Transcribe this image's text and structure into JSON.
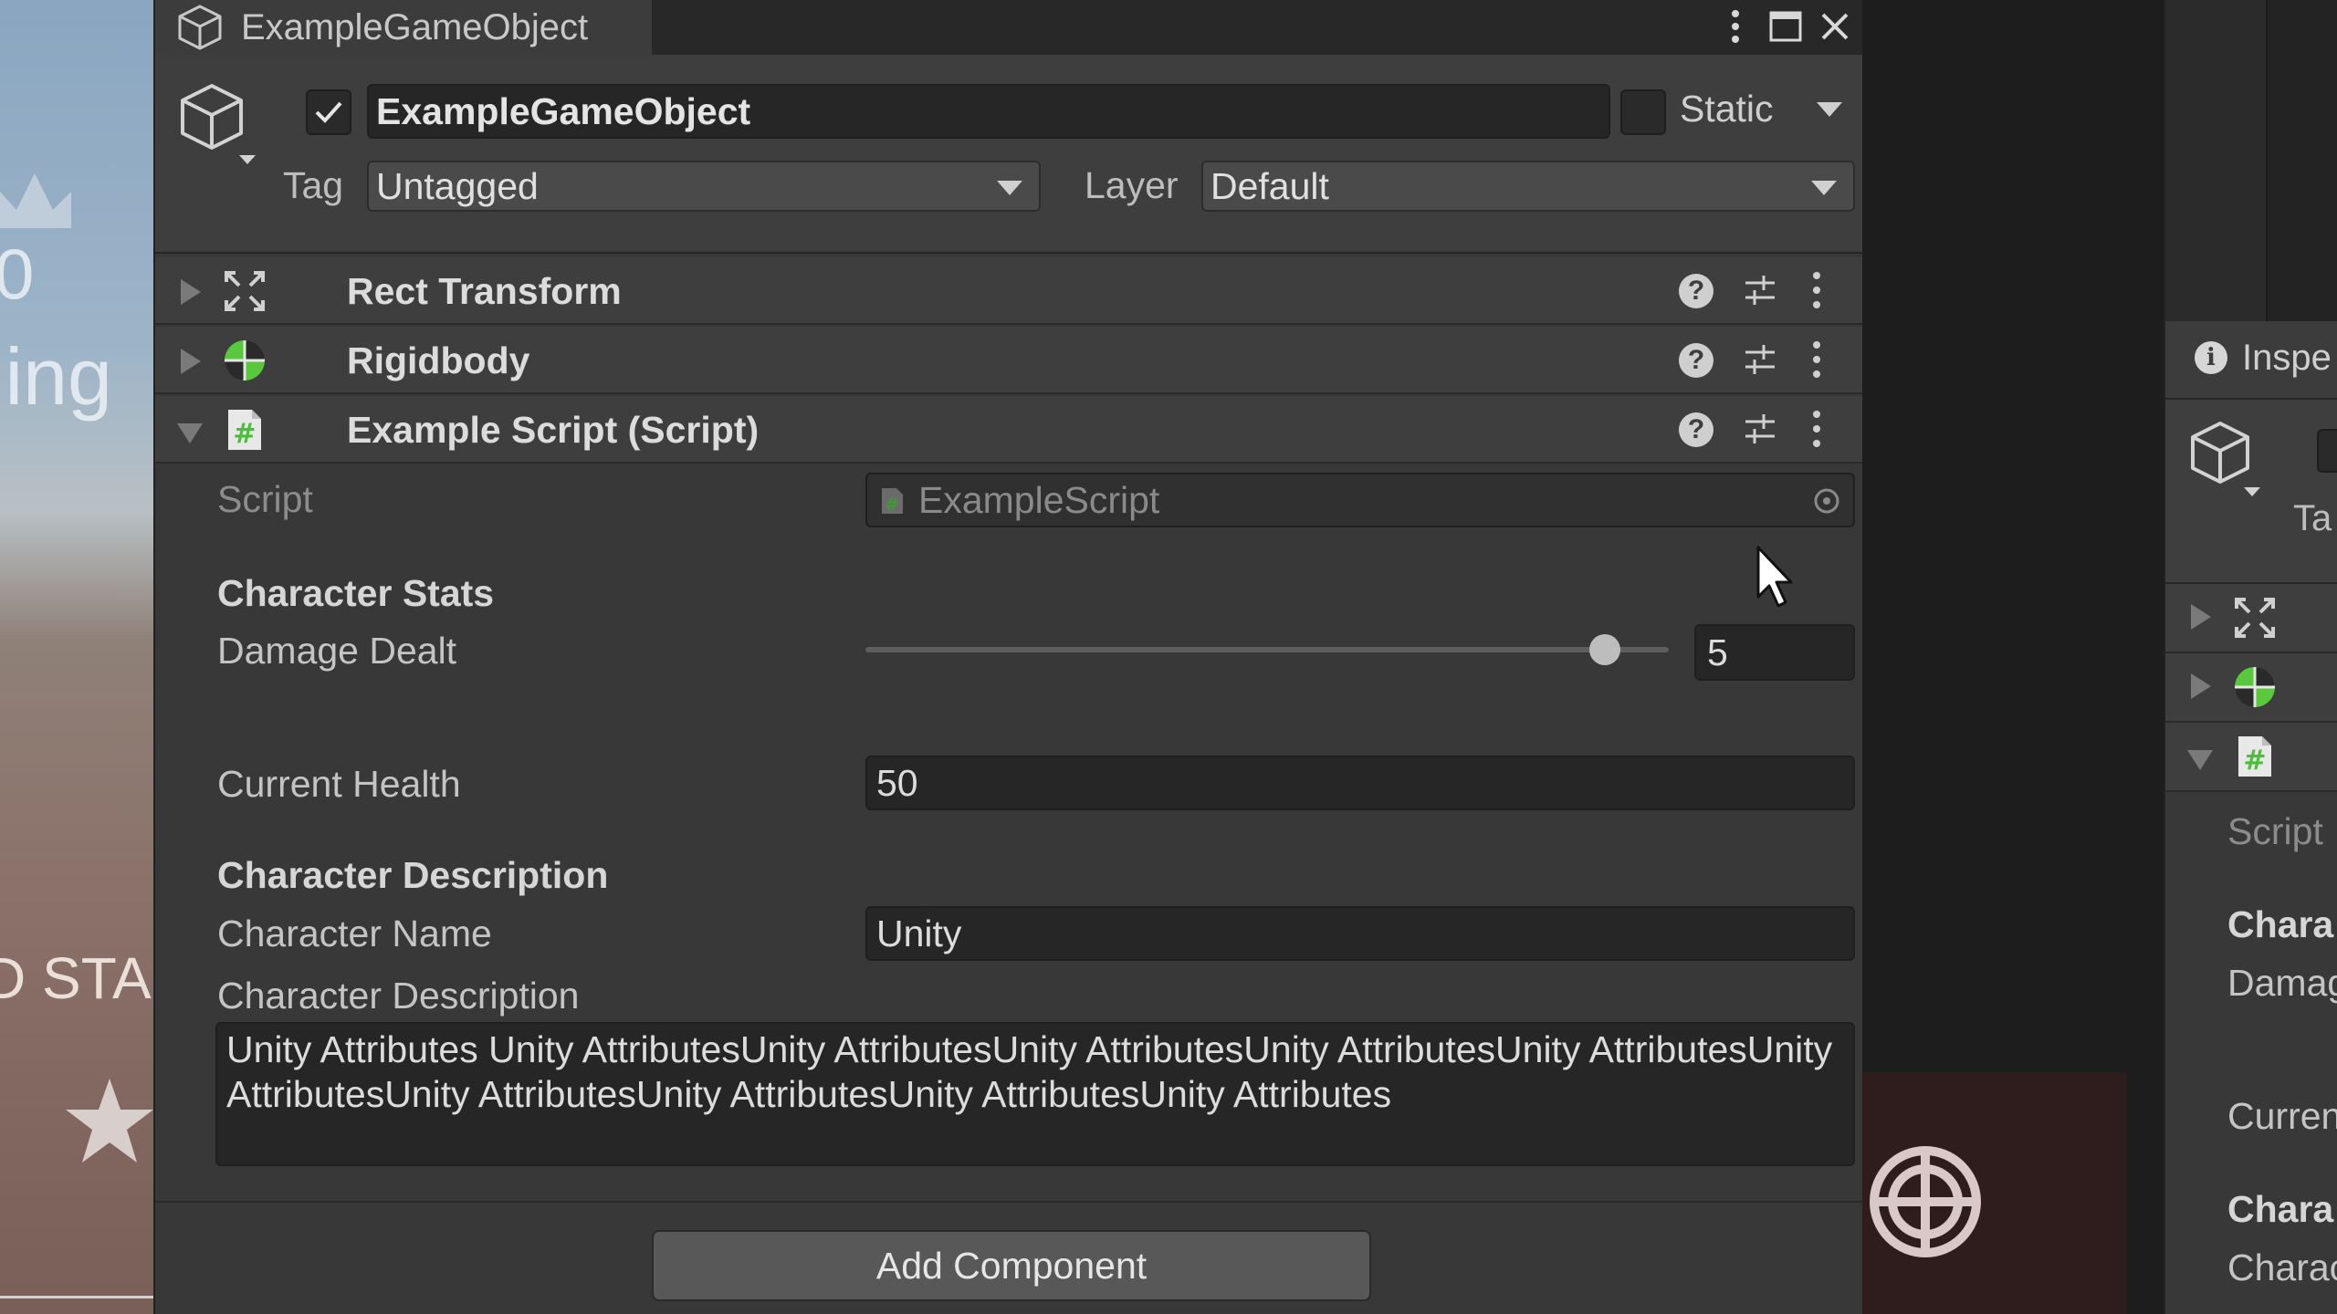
{
  "window": {
    "tab_title": "ExampleGameObject",
    "controls": [
      "more-icon",
      "maximize-icon",
      "close-icon"
    ]
  },
  "game_object": {
    "active": true,
    "name": "ExampleGameObject",
    "static_label": "Static",
    "static_checked": false,
    "tag_label": "Tag",
    "tag_value": "Untagged",
    "layer_label": "Layer",
    "layer_value": "Default"
  },
  "components": [
    {
      "title": "Rect Transform",
      "icon": "rect-transform-icon",
      "expanded": false
    },
    {
      "title": "Rigidbody",
      "icon": "rigidbody-icon",
      "expanded": false
    },
    {
      "title": "Example Script (Script)",
      "icon": "script-icon",
      "expanded": true
    }
  ],
  "script": {
    "label": "Script",
    "value": "ExampleScript",
    "section_stats": "Character Stats",
    "damage_label": "Damage Dealt",
    "damage_value": "5",
    "damage_fraction": 0.92,
    "health_label": "Current Health",
    "health_value": "50",
    "section_description": "Character Description",
    "name_label": "Character Name",
    "name_value": "Unity",
    "description_label": "Character Description",
    "description_value": "Unity Attributes Unity AttributesUnity AttributesUnity AttributesUnity AttributesUnity AttributesUnity AttributesUnity AttributesUnity AttributesUnity AttributesUnity Attributes"
  },
  "add_component_label": "Add Component",
  "game_view": {
    "partial_texts": [
      "0",
      "ling",
      "D STA"
    ]
  },
  "second_inspector": {
    "tab_title": "Inspe",
    "tag_partial": "Ta",
    "script_label": "Script",
    "section_partial": "Chara",
    "damage_partial": "Damag",
    "health_partial": "Curren",
    "section2_partial": "Chara",
    "name_partial": "Charac"
  },
  "colors": {
    "panel_bg": "#383838",
    "field_bg": "#262626",
    "header_bg": "#3e3e3e",
    "text": "#d2d2d2",
    "rigidbody_green": "#5ac83c",
    "script_green": "#4bbf3a"
  }
}
